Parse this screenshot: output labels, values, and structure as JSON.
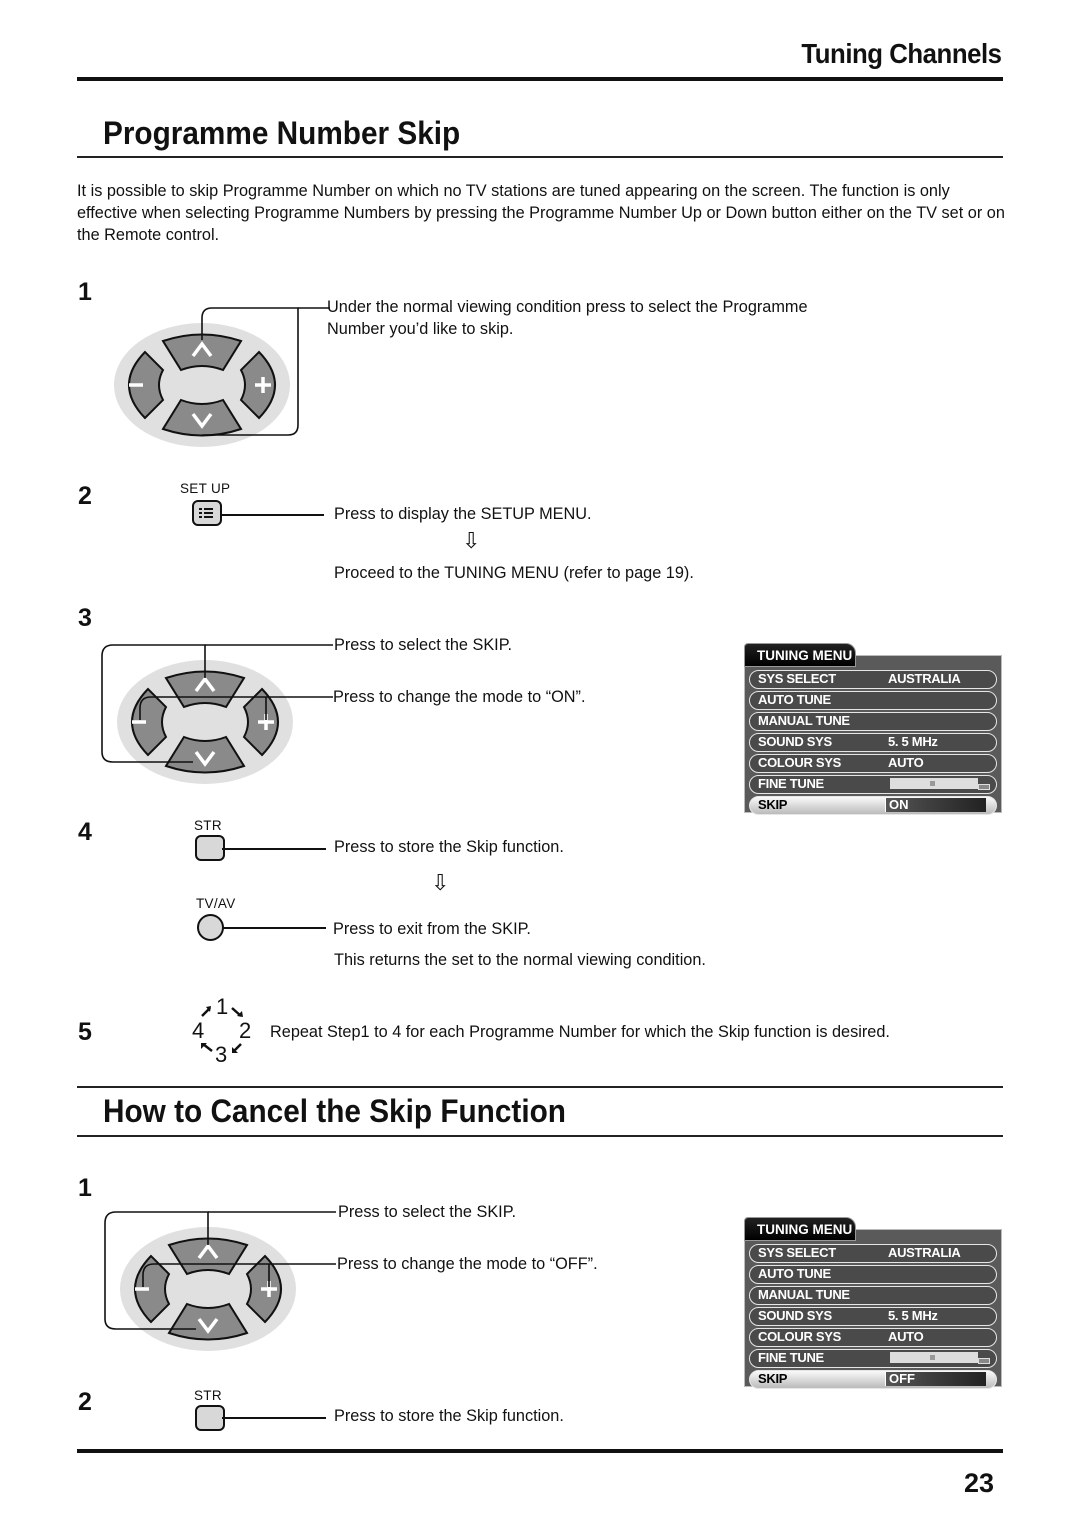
{
  "header": {
    "section_title": "Tuning Channels"
  },
  "section1": {
    "title": "Programme Number Skip",
    "intro": "It is possible to skip Programme Number on which no TV stations are tuned appearing on the screen. The function is only effective when selecting Programme Numbers by pressing the Programme Number Up or Down button either on the TV set or on the Remote control.",
    "steps": [
      {
        "number": "1",
        "text": "Under the normal viewing condition press to select the Programme Number you’d like to skip."
      },
      {
        "number": "2",
        "button_label": "SET UP",
        "text": "Press to display the SETUP MENU.",
        "text2": "Proceed to the TUNING MENU (refer to page 19)."
      },
      {
        "number": "3",
        "text": "Press to select the SKIP.",
        "text2": "Press to change the mode to “ON”."
      },
      {
        "number": "4",
        "button_label": "STR",
        "text": "Press to store the Skip function.",
        "button2_label": "TV/AV",
        "text2": "Press to exit from  the SKIP.",
        "text3": "This returns the set to the normal viewing condition."
      },
      {
        "number": "5",
        "cycle": [
          "1",
          "2",
          "3",
          "4"
        ],
        "text": "Repeat Step1 to 4 for each Programme Number for which the Skip function is desired."
      }
    ],
    "menu": {
      "title": "TUNING MENU",
      "rows": [
        {
          "label": "SYS SELECT",
          "value": "AUSTRALIA"
        },
        {
          "label": "AUTO  TUNE",
          "value": ""
        },
        {
          "label": "MANUAL  TUNE",
          "value": ""
        },
        {
          "label": "SOUND  SYS",
          "value": "5. 5 MHz"
        },
        {
          "label": "COLOUR  SYS",
          "value": "AUTO"
        },
        {
          "label": "FINE  TUNE",
          "value": ""
        },
        {
          "label": "SKIP",
          "value": "ON"
        }
      ]
    }
  },
  "section2": {
    "title": "How to Cancel the Skip Function",
    "steps": [
      {
        "number": "1",
        "text": "Press to select the SKIP.",
        "text2": "Press to change the mode to “OFF”."
      },
      {
        "number": "2",
        "button_label": "STR",
        "text": "Press to store the Skip function."
      }
    ],
    "menu": {
      "title": "TUNING MENU",
      "rows": [
        {
          "label": "SYS SELECT",
          "value": "AUSTRALIA"
        },
        {
          "label": "AUTO  TUNE",
          "value": ""
        },
        {
          "label": "MANUAL  TUNE",
          "value": ""
        },
        {
          "label": "SOUND  SYS",
          "value": "5. 5 MHz"
        },
        {
          "label": "COLOUR  SYS",
          "value": "AUTO"
        },
        {
          "label": "FINE  TUNE",
          "value": ""
        },
        {
          "label": "SKIP",
          "value": "OFF"
        }
      ]
    }
  },
  "dpad": {
    "up": "^",
    "down": "v",
    "left": "−",
    "right": "+"
  },
  "arrow_glyph": "⇩",
  "footer": {
    "page_number": "23"
  }
}
